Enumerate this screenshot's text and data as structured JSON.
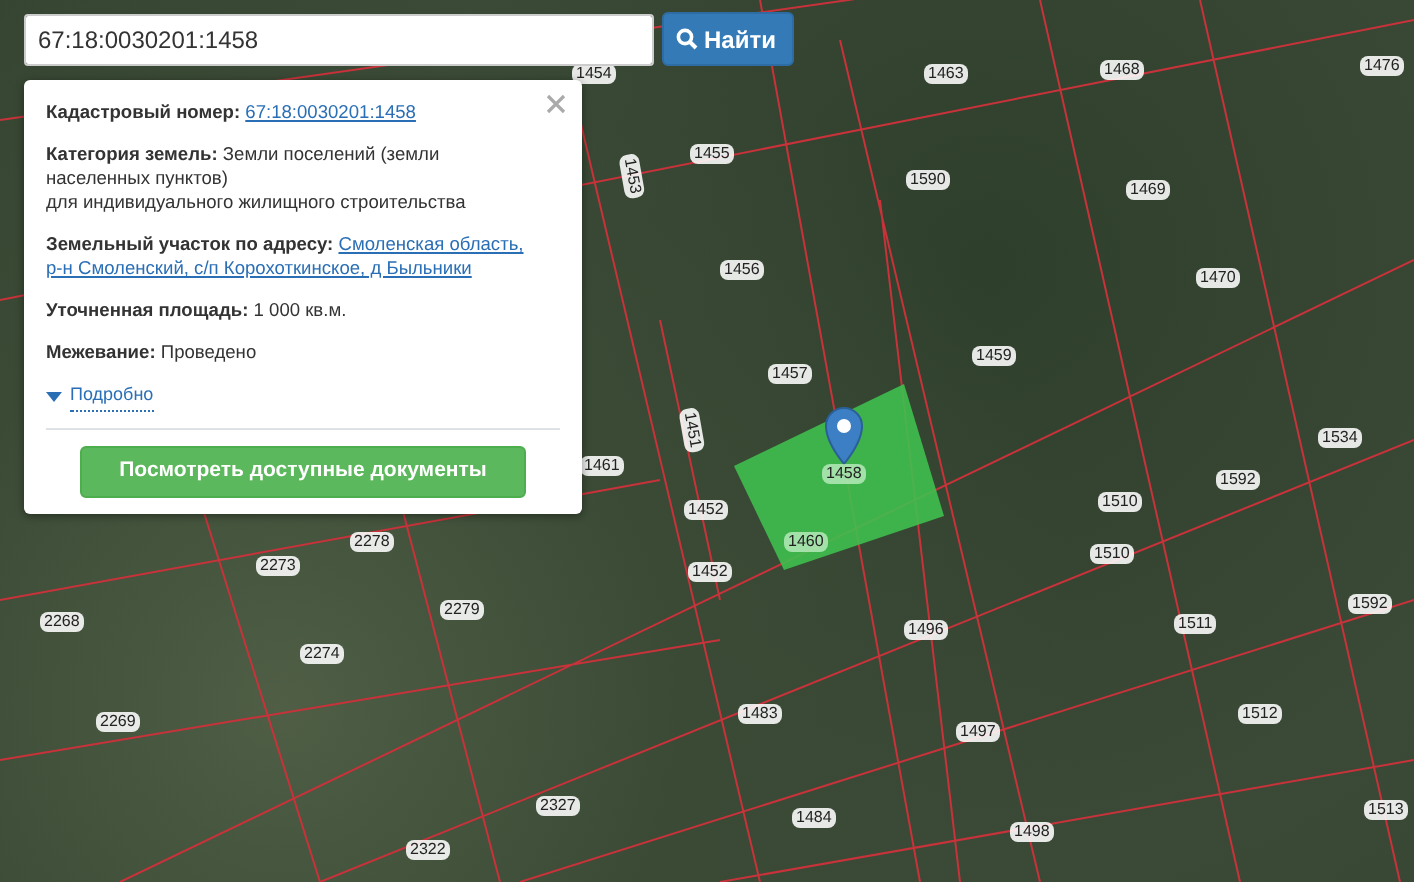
{
  "search": {
    "value": "67:18:0030201:1458",
    "button": "Найти"
  },
  "popup": {
    "fields": [
      {
        "kind": "link",
        "label": "Кадастровый номер:",
        "lines": [
          "67:18:0030201:1458"
        ]
      },
      {
        "kind": "text",
        "label": "Категория земель:",
        "lines": [
          "Земли поселений (земли",
          "населенных пунктов)",
          "для индивидуального жилищного строительства"
        ]
      },
      {
        "kind": "link",
        "label": "Земельный участок по адресу:",
        "lines": [
          "Смоленская область,",
          "р-н Смоленский, с/п Корохоткинское, д Быльники"
        ]
      },
      {
        "kind": "text",
        "label": "Уточненная площадь:",
        "lines": [
          "1 000 кв.м."
        ]
      },
      {
        "kind": "text",
        "label": "Межевание:",
        "lines": [
          "Проведено"
        ]
      }
    ],
    "more_link": "Подробно",
    "documents_button": "Посмотреть доступные документы"
  },
  "map": {
    "parcel_labels": [
      "1454",
      "1463",
      "1468",
      "1476",
      "1455",
      "1453",
      "1590",
      "1469",
      "1456",
      "1470",
      "1459",
      "1457",
      "1461",
      "1451",
      "1534",
      "1592",
      "1452",
      "1452",
      "1510",
      "1510",
      "2278",
      "2273",
      "2279",
      "2268",
      "2274",
      "2269",
      "1496",
      "1511",
      "1592",
      "1483",
      "1497",
      "1512",
      "2327",
      "1484",
      "1498",
      "1513",
      "2322"
    ],
    "selected_parcel": {
      "labels": [
        "1458",
        "1460"
      ]
    }
  }
}
